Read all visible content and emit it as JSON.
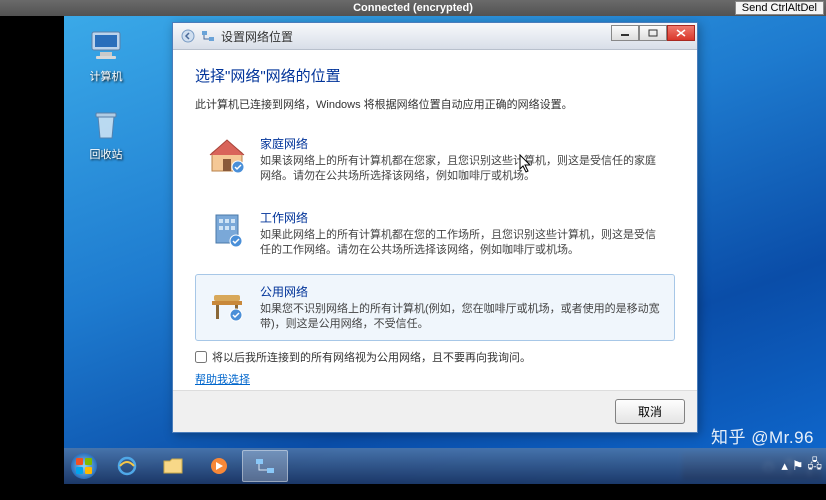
{
  "vnc": {
    "title": "Connected (encrypted)",
    "send_cad": "Send CtrlAltDel"
  },
  "desktop_icons": {
    "computer": "计算机",
    "recycle": "回收站"
  },
  "dialog": {
    "window_title": "设置网络位置",
    "heading": "选择\"网络\"网络的位置",
    "subtext": "此计算机已连接到网络，Windows 将根据网络位置自动应用正确的网络设置。",
    "options": [
      {
        "title": "家庭网络",
        "desc": "如果该网络上的所有计算机都在您家，且您识别这些计算机，则这是受信任的家庭网络。请勿在公共场所选择该网络，例如咖啡厅或机场。"
      },
      {
        "title": "工作网络",
        "desc": "如果此网络上的所有计算机都在您的工作场所，且您识别这些计算机，则这是受信任的工作网络。请勿在公共场所选择该网络，例如咖啡厅或机场。"
      },
      {
        "title": "公用网络",
        "desc": "如果您不识别网络上的所有计算机(例如，您在咖啡厅或机场，或者使用的是移动宽带)，则这是公用网络，不受信任。"
      }
    ],
    "checkbox_label": "将以后我所连接到的所有网络视为公用网络，且不要再向我询问。",
    "help_link": "帮助我选择",
    "cancel_btn": "取消"
  },
  "watermark": "知乎 @Mr.96"
}
